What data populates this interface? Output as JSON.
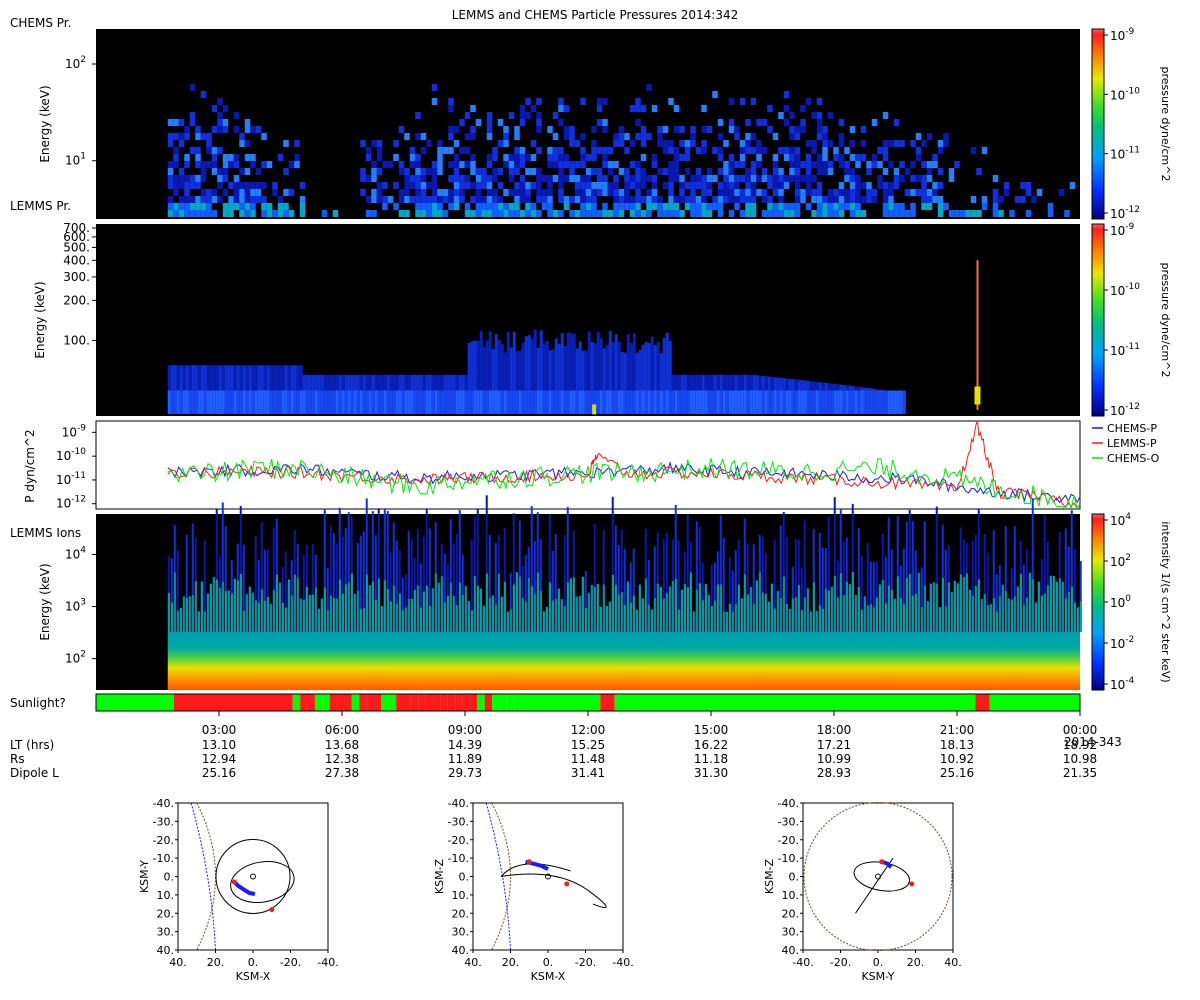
{
  "title": "LEMMS and CHEMS Particle Pressures  2014:342",
  "colors": {
    "panel_bg": "#000000",
    "sunlight_on": "#00ff00",
    "sunlight_off": "#ff1a1a",
    "chems_p": "#1a1aff",
    "lemms_p": "#ff1a1a",
    "chems_o": "#00ee00",
    "magnetopause": "#8b4513",
    "bow_shock": "#1a1aff"
  },
  "chart_data": [
    {
      "type": "heatmap",
      "name": "chems",
      "panel_label": "CHEMS Pr.",
      "ylabel": "Energy (keV)",
      "yscale": "log",
      "ylim": [
        2.5,
        230
      ],
      "yticks": [
        {
          "v": 10,
          "label": "10",
          "sup": "1"
        },
        {
          "v": 100,
          "label": "10",
          "sup": "2"
        }
      ],
      "xlim": [
        0,
        24
      ],
      "data_start_hr": 1.75,
      "colorbar": {
        "label": "pressure dyne/cm^2",
        "scale": "log",
        "range": [
          1e-12,
          1e-09
        ],
        "ticks": [
          {
            "label": "10",
            "sup": "-9"
          },
          {
            "label": "10",
            "sup": "-10"
          },
          {
            "label": "10",
            "sup": "-11"
          },
          {
            "label": "10",
            "sup": "-12"
          }
        ]
      }
    },
    {
      "type": "heatmap",
      "name": "lemms_pr",
      "panel_label": "LEMMS Pr.",
      "ylabel": "Energy (keV)",
      "yscale": "log",
      "ylim": [
        27,
        750
      ],
      "yticks": [
        {
          "v": 100,
          "label": "100."
        },
        {
          "v": 200,
          "label": "200."
        },
        {
          "v": 300,
          "label": "300."
        },
        {
          "v": 400,
          "label": "400."
        },
        {
          "v": 500,
          "label": "500."
        },
        {
          "v": 600,
          "label": "600."
        },
        {
          "v": 700,
          "label": "700."
        }
      ],
      "xlim": [
        0,
        24
      ],
      "data_start_hr": 1.75,
      "spike_hr": 21.5,
      "colorbar": {
        "label": "pressure dyne/cm^2",
        "scale": "log",
        "range": [
          1e-12,
          1e-09
        ],
        "ticks": [
          {
            "label": "10",
            "sup": "-9"
          },
          {
            "label": "10",
            "sup": "-10"
          },
          {
            "label": "10",
            "sup": "-11"
          },
          {
            "label": "10",
            "sup": "-12"
          }
        ]
      }
    },
    {
      "type": "line",
      "name": "pressure",
      "ylabel": "P dyn/cm^2",
      "yscale": "log",
      "ylim": [
        6e-13,
        3e-09
      ],
      "yticks": [
        {
          "v": 1e-09,
          "label": "10",
          "sup": "-9"
        },
        {
          "v": 1e-10,
          "label": "10",
          "sup": "-10"
        },
        {
          "v": 1e-11,
          "label": "10",
          "sup": "-11"
        },
        {
          "v": 1e-12,
          "label": "10",
          "sup": "-12"
        }
      ],
      "xlim": [
        0,
        24
      ],
      "legend_position": "right",
      "series": [
        {
          "name": "CHEMS-P",
          "color": "#1a1aff",
          "x": [
            1.75,
            3,
            4,
            5,
            6,
            7,
            8,
            9,
            10,
            11,
            12,
            13,
            14,
            15,
            16,
            17,
            18,
            19,
            20,
            21,
            22,
            23,
            24
          ],
          "y": [
            2e-11,
            2.5e-11,
            2.5e-11,
            3e-11,
            2e-11,
            1.5e-11,
            1.2e-11,
            1.5e-11,
            1.5e-11,
            1.8e-11,
            2e-11,
            2.5e-11,
            3e-11,
            2.5e-11,
            2e-11,
            1.8e-11,
            1.5e-11,
            1.2e-11,
            1e-11,
            5e-12,
            3e-12,
            2e-12,
            2e-12
          ]
        },
        {
          "name": "LEMMS-P",
          "color": "#ff1a1a",
          "x": [
            1.75,
            3,
            4,
            5,
            6,
            7,
            8,
            9,
            10,
            11,
            12,
            12.2,
            13,
            14,
            15,
            16,
            17,
            18,
            19,
            20,
            21,
            21.5,
            22,
            23,
            24
          ],
          "y": [
            2e-11,
            2e-11,
            2.2e-11,
            2e-11,
            1.5e-11,
            1.2e-11,
            1e-11,
            1.2e-11,
            1.3e-11,
            1.5e-11,
            1.5e-11,
            1e-10,
            1.8e-11,
            2e-11,
            1.8e-11,
            1.5e-11,
            1.2e-11,
            1e-11,
            8e-12,
            6e-12,
            4e-12,
            2e-09,
            3e-12,
            2e-12,
            1e-12
          ]
        },
        {
          "name": "CHEMS-O",
          "color": "#00ee00",
          "x": [
            1.75,
            3,
            4,
            5,
            6,
            7,
            8,
            9,
            10,
            11,
            12,
            13,
            14,
            15,
            16,
            17,
            18,
            19,
            20,
            21,
            22,
            23,
            24
          ],
          "y": [
            1.5e-11,
            2e-11,
            3e-11,
            3e-11,
            1.5e-11,
            8e-12,
            5e-12,
            1e-11,
            1.2e-11,
            1.5e-11,
            2e-11,
            2e-11,
            2.5e-11,
            3e-11,
            2.5e-11,
            2e-11,
            2.5e-11,
            3e-11,
            2e-11,
            1e-11,
            4e-12,
            2e-12,
            1e-12
          ]
        }
      ]
    },
    {
      "type": "heatmap",
      "name": "lemms_ions",
      "panel_label": "LEMMS Ions",
      "ylabel": "Energy (keV)",
      "yscale": "log",
      "ylim": [
        25,
        60000
      ],
      "yticks": [
        {
          "v": 100,
          "label": "10",
          "sup": "2"
        },
        {
          "v": 1000,
          "label": "10",
          "sup": "3"
        },
        {
          "v": 10000,
          "label": "10",
          "sup": "4"
        }
      ],
      "xlim": [
        0,
        24
      ],
      "data_start_hr": 1.75,
      "colorbar": {
        "label": "intensity 1/(s cm^2 ster keV)",
        "scale": "log",
        "range": [
          3e-05,
          10000.0
        ],
        "ticks": [
          {
            "label": "10",
            "sup": "4"
          },
          {
            "label": "10",
            "sup": "2"
          },
          {
            "label": "10",
            "sup": "0"
          },
          {
            "label": "10",
            "sup": "-2"
          },
          {
            "label": "10",
            "sup": "-4"
          }
        ]
      }
    },
    {
      "type": "bar",
      "name": "sunlight",
      "panel_label": "Sunlight?",
      "xlim": [
        0,
        24
      ],
      "segments": [
        {
          "start": 0,
          "end": 1.9,
          "sun": true
        },
        {
          "start": 1.9,
          "end": 4.8,
          "sun": false
        },
        {
          "start": 4.8,
          "end": 10.2,
          "sun": "mixed"
        },
        {
          "start": 10.2,
          "end": 12.3,
          "sun": true
        },
        {
          "start": 12.3,
          "end": 12.65,
          "sun": false
        },
        {
          "start": 12.65,
          "end": 21.45,
          "sun": true
        },
        {
          "start": 21.45,
          "end": 21.8,
          "sun": false
        },
        {
          "start": 21.8,
          "end": 24,
          "sun": true
        }
      ]
    },
    {
      "type": "table",
      "name": "ephemeris",
      "x_ticks": [
        "03:00",
        "06:00",
        "09:00",
        "12:00",
        "15:00",
        "18:00",
        "21:00",
        "00:00"
      ],
      "tick_hours": [
        3,
        6,
        9,
        12,
        15,
        18,
        21,
        24
      ],
      "end_date_label": "2014-343",
      "rows": [
        {
          "label": "LT (hrs)",
          "values": [
            "13.10",
            "13.68",
            "14.39",
            "15.25",
            "16.22",
            "17.21",
            "18.13",
            "18.92"
          ]
        },
        {
          "label": "Rs",
          "values": [
            "12.94",
            "12.38",
            "11.89",
            "11.48",
            "11.18",
            "10.99",
            "10.92",
            "10.98"
          ]
        },
        {
          "label": "Dipole L",
          "values": [
            "25.16",
            "27.38",
            "29.73",
            "31.41",
            "31.30",
            "28.93",
            "25.16",
            "21.35"
          ]
        }
      ]
    },
    {
      "type": "scatter",
      "name": "orbit_xy",
      "xlabel": "KSM-X",
      "ylabel": "KSM-Y",
      "xlim": [
        40,
        -40
      ],
      "ylim": [
        -40,
        40
      ],
      "xticks": [
        "40.",
        "20.",
        "0.",
        "-20.",
        "-40."
      ],
      "yticks": [
        "-40.",
        "-30.",
        "-20.",
        "-10.",
        "0.",
        "10.",
        "20.",
        "30.",
        "40."
      ],
      "orbit_center": [
        0,
        0
      ],
      "orbit_radius": [
        20,
        20
      ],
      "day_track": [
        [
          10,
          3
        ],
        [
          8,
          5
        ],
        [
          5,
          7
        ],
        [
          2,
          9
        ],
        [
          -1,
          9.5
        ]
      ],
      "markers": [
        [
          -10,
          18
        ],
        [
          10,
          3
        ]
      ]
    },
    {
      "type": "scatter",
      "name": "orbit_xz",
      "xlabel": "KSM-X",
      "ylabel": "KSM-Z",
      "xlim": [
        40,
        -40
      ],
      "ylim": [
        -40,
        40
      ],
      "xticks": [
        "40.",
        "20.",
        "0.",
        "-20.",
        "-40."
      ],
      "yticks": [
        "-40.",
        "-30.",
        "-20.",
        "-10.",
        "0.",
        "10.",
        "20.",
        "30.",
        "40."
      ],
      "orbit_center": [
        0,
        0
      ],
      "orbit_radius": [
        0,
        0
      ],
      "day_track": [
        [
          12,
          -8
        ],
        [
          8,
          -7
        ],
        [
          4,
          -6
        ],
        [
          0,
          -4
        ]
      ],
      "markers": [
        [
          -10,
          4
        ],
        [
          10,
          -8
        ]
      ]
    },
    {
      "type": "scatter",
      "name": "orbit_yz",
      "xlabel": "KSM-Y",
      "ylabel": "KSM-Z",
      "xlim": [
        -40,
        40
      ],
      "ylim": [
        -40,
        40
      ],
      "xticks": [
        "-40.",
        "-20.",
        "0.",
        "20.",
        "40."
      ],
      "yticks": [
        "-40.",
        "-30.",
        "-20.",
        "-10.",
        "0.",
        "10.",
        "20.",
        "30.",
        "40."
      ],
      "orbit_center": [
        0,
        0
      ],
      "orbit_radius": [
        0,
        0
      ],
      "day_track": [
        [
          2,
          -8
        ],
        [
          5,
          -7
        ],
        [
          7,
          -5
        ]
      ],
      "markers": [
        [
          18,
          4
        ],
        [
          2,
          -8
        ]
      ]
    }
  ]
}
